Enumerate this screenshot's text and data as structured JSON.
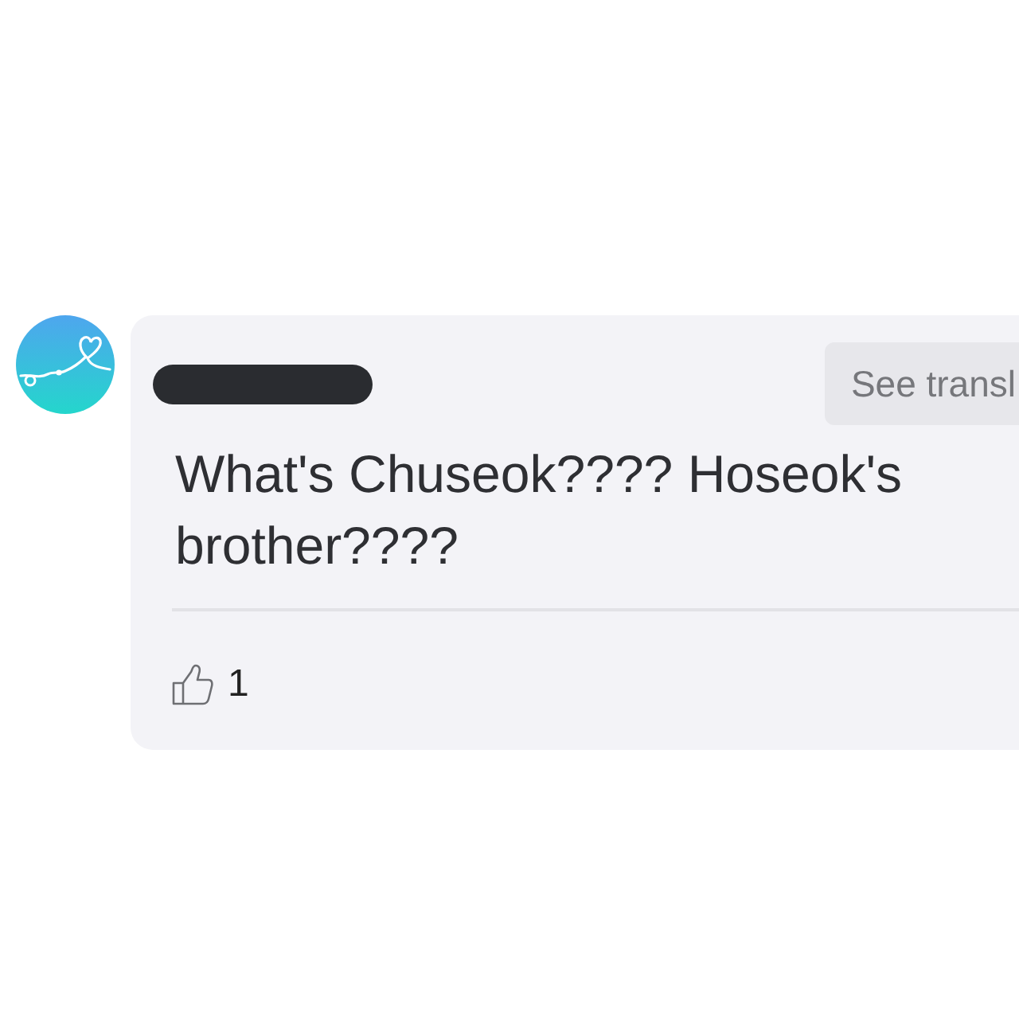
{
  "comment": {
    "author": {
      "redacted": true
    },
    "translate_button": "See transl",
    "text": "What's Chuseok???? Hoseok's brother????",
    "likes": {
      "count": "1"
    }
  }
}
